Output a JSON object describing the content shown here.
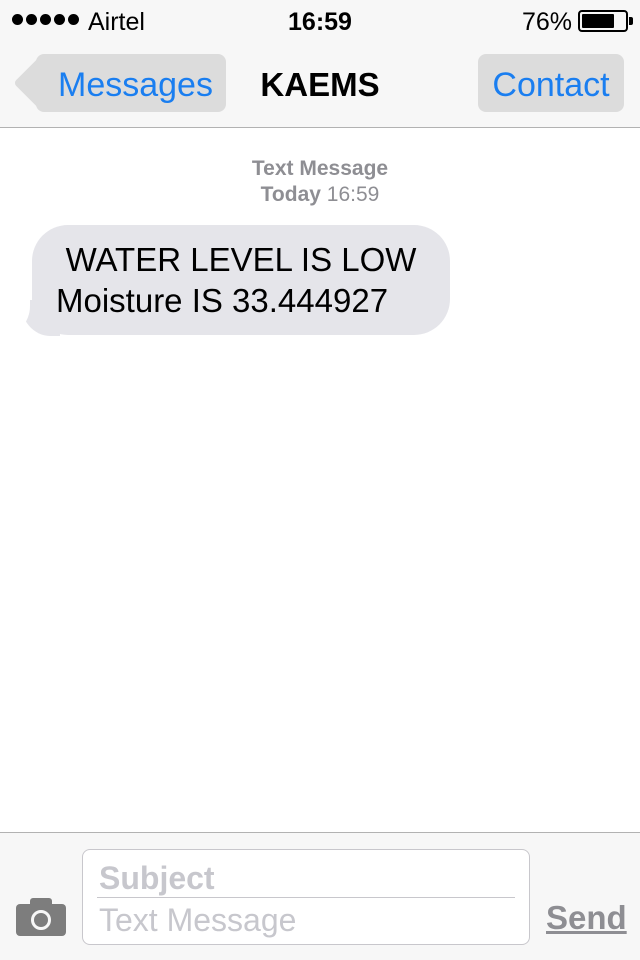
{
  "status_bar": {
    "carrier": "Airtel",
    "signal_bars": 5,
    "time": "16:59",
    "battery_percent": "76%",
    "battery_level": 0.76
  },
  "nav": {
    "back_label": "Messages",
    "title": "KAEMS",
    "contact_label": "Contact"
  },
  "conversation": {
    "meta_type": "Text Message",
    "meta_day": "Today",
    "meta_time": "16:59",
    "messages": [
      {
        "line1": "WATER LEVEL IS LOW",
        "line2": "Moisture IS 33.444927"
      }
    ]
  },
  "composer": {
    "camera_icon": "camera-icon",
    "subject_placeholder": "Subject",
    "text_placeholder": "Text Message",
    "send_label": "Send"
  },
  "colors": {
    "accent": "#1a7ef0",
    "bubble": "#e5e5ea",
    "placeholder": "#c7c7cd"
  }
}
